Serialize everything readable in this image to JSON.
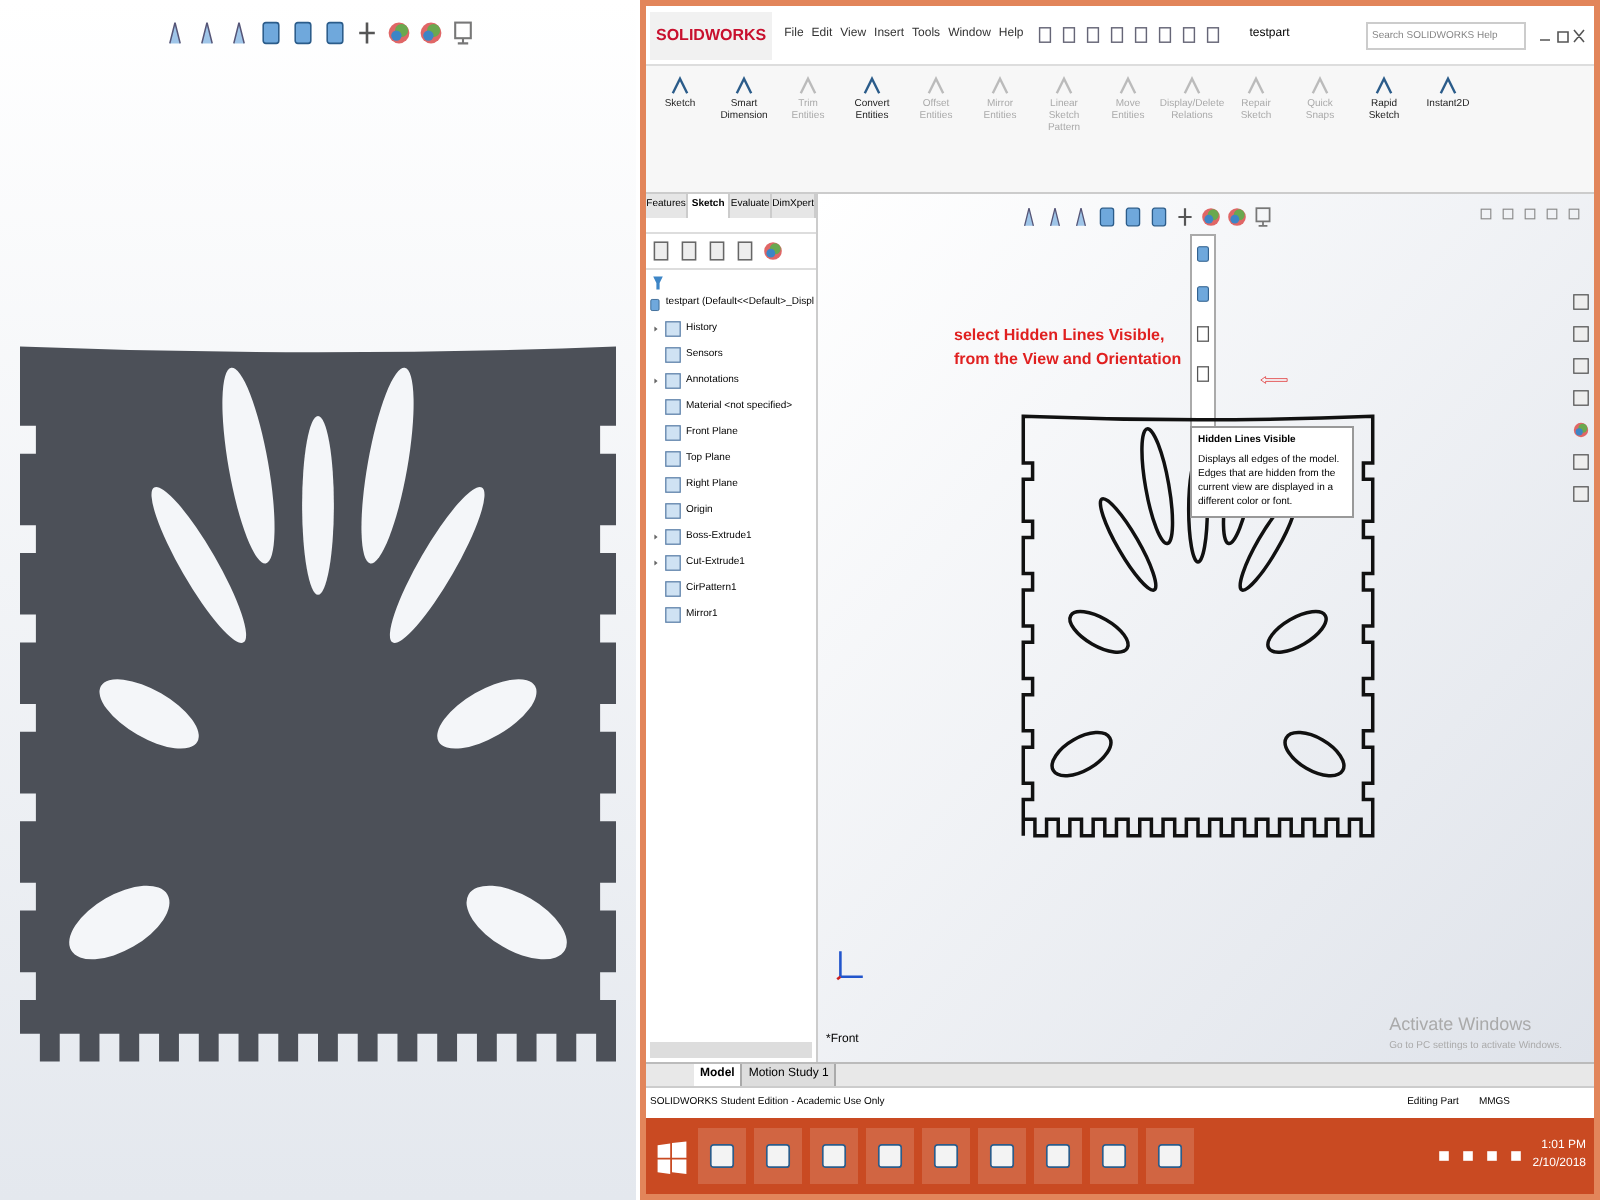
{
  "app": {
    "logo": "SOLIDWORKS",
    "menu": [
      "File",
      "Edit",
      "View",
      "Insert",
      "Tools",
      "Window",
      "Help"
    ],
    "document": "testpart",
    "search": {
      "placeholder": "Search SOLIDWORKS Help"
    },
    "ribbon": [
      {
        "label": "Sketch",
        "disabled": false
      },
      {
        "label": "Smart Dimension",
        "disabled": false
      },
      {
        "label": "Trim Entities",
        "disabled": true
      },
      {
        "label": "Convert Entities",
        "disabled": false
      },
      {
        "label": "Offset Entities",
        "disabled": true
      },
      {
        "label": "Mirror Entities",
        "disabled": true
      },
      {
        "label": "Linear Sketch Pattern",
        "disabled": true
      },
      {
        "label": "Move Entities",
        "disabled": true
      },
      {
        "label": "Display/Delete Relations",
        "disabled": true
      },
      {
        "label": "Repair Sketch",
        "disabled": true
      },
      {
        "label": "Quick Snaps",
        "disabled": true
      },
      {
        "label": "Rapid Sketch",
        "disabled": false
      },
      {
        "label": "Instant2D",
        "disabled": false
      }
    ],
    "tabs": [
      {
        "label": "Features",
        "selected": false
      },
      {
        "label": "Sketch",
        "selected": true
      },
      {
        "label": "Evaluate",
        "selected": false
      },
      {
        "label": "DimXpert",
        "selected": false
      }
    ],
    "tree": [
      {
        "label": "testpart (Default<<Default>_Displ",
        "children": [
          {
            "label": "History",
            "expandable": true
          },
          {
            "label": "Sensors",
            "expandable": false
          },
          {
            "label": "Annotations",
            "expandable": true
          },
          {
            "label": "Material <not specified>",
            "expandable": false
          },
          {
            "label": "Front Plane",
            "expandable": false
          },
          {
            "label": "Top Plane",
            "expandable": false
          },
          {
            "label": "Right Plane",
            "expandable": false
          },
          {
            "label": "Origin",
            "expandable": false
          },
          {
            "label": "Boss-Extrude1",
            "expandable": true
          },
          {
            "label": "Cut-Extrude1",
            "expandable": true
          },
          {
            "label": "CirPattern1",
            "expandable": false
          },
          {
            "label": "Mirror1",
            "expandable": false
          }
        ]
      }
    ],
    "annotation": [
      "select Hidden Lines Visible,",
      "from the View and Orientation"
    ],
    "tooltip": {
      "title": "Hidden Lines Visible",
      "body": "Displays all edges of the model. Edges that are hidden from the current view are displayed in a different color or font."
    },
    "view_label": "*Front",
    "activation": {
      "title": "Activate Windows",
      "body": "Go to PC settings to activate Windows."
    },
    "bottom_tabs": [
      {
        "label": "Model",
        "selected": true
      },
      {
        "label": "Motion Study 1",
        "selected": false
      }
    ],
    "status_bar": {
      "edition": "SOLIDWORKS Student Edition - Academic Use Only",
      "mode": "Editing Part",
      "units": "MMGS"
    },
    "taskbar": {
      "time": "1:01 PM",
      "date": "2/10/2018"
    }
  }
}
